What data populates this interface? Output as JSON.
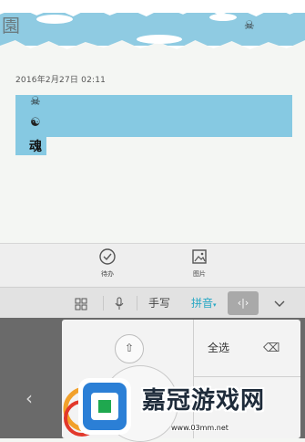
{
  "note": {
    "header_left_glyph": "園",
    "header_symbol": "☠",
    "timestamp": "2016年2月27日 02:11",
    "symbols": [
      "☠",
      "☯",
      "魂"
    ]
  },
  "toolbar": {
    "todo_label": "待办",
    "image_label": "图片"
  },
  "keyboard": {
    "bar": {
      "grid_icon": "grid-icon",
      "mic_icon": "microphone-icon",
      "handwrite_label": "手写",
      "pinyin_label": "拼音",
      "cursor_icon": "‹|›",
      "collapse_icon": "chevron-down-icon"
    },
    "panel": {
      "up_arrow": "⇧",
      "select_all_label": "全选",
      "delete_icon": "⌫"
    },
    "left_arrow": "‹"
  },
  "watermark": {
    "text": "嘉冠游戏网",
    "url": "www.03mm.net"
  },
  "colors": {
    "selection": "#86c9e2",
    "accent": "#2aa8c4",
    "keyboard_bg": "#6a6a6a"
  }
}
